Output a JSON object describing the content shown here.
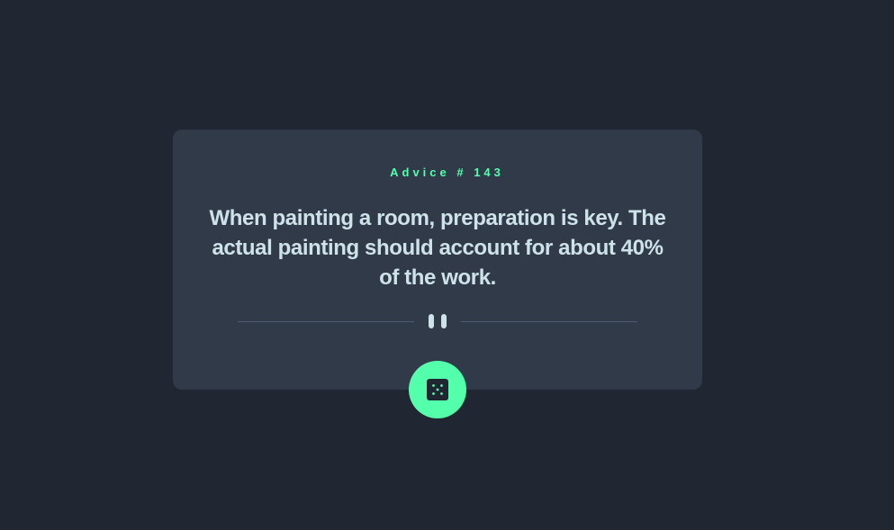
{
  "advice": {
    "id_label": "Advice # 143",
    "text": "When painting a room, preparation is key. The actual painting should account for about 40% of the work."
  },
  "icons": {
    "divider": "pause-icon",
    "button": "dice-icon"
  },
  "colors": {
    "background": "#202632",
    "card": "#313a48",
    "accent": "#53ffaa",
    "text": "#cee3e9",
    "divider": "#4f5d74"
  }
}
